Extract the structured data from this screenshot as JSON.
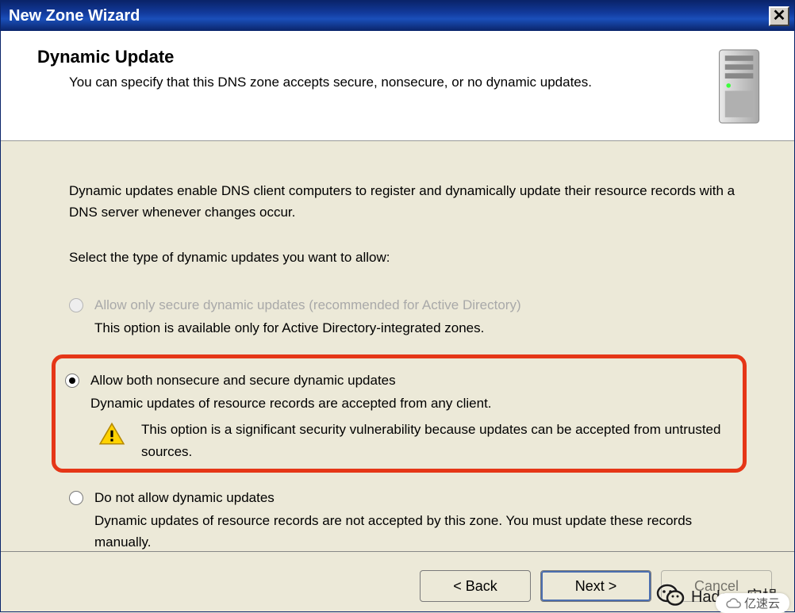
{
  "window_title": "New Zone Wizard",
  "close_label": "✕",
  "header": {
    "title": "Dynamic Update",
    "subtitle": "You can specify that this DNS zone accepts secure, nonsecure, or no dynamic updates."
  },
  "intro": "Dynamic updates enable DNS client computers to register and dynamically update their resource records with a DNS server whenever changes occur.",
  "prompt": "Select the type of dynamic updates you want to allow:",
  "options": {
    "secure": {
      "label": "Allow only secure dynamic updates (recommended for Active Directory)",
      "desc": "This option is available only for Active Directory-integrated zones.",
      "enabled": false,
      "selected": false
    },
    "both": {
      "label": "Allow both nonsecure and secure dynamic updates",
      "desc": "Dynamic updates of resource records are accepted from any client.",
      "warning": "This option is a significant security vulnerability because updates can be accepted from untrusted sources.",
      "enabled": true,
      "selected": true
    },
    "none": {
      "label": "Do not allow dynamic updates",
      "desc": "Dynamic updates of resource records are not accepted by this zone. You must update these records manually.",
      "enabled": true,
      "selected": false
    }
  },
  "buttons": {
    "back": "< Back",
    "next": "Next >",
    "cancel": "Cancel"
  },
  "watermark_text": "Hadoop实操",
  "brand_badge": "亿速云"
}
